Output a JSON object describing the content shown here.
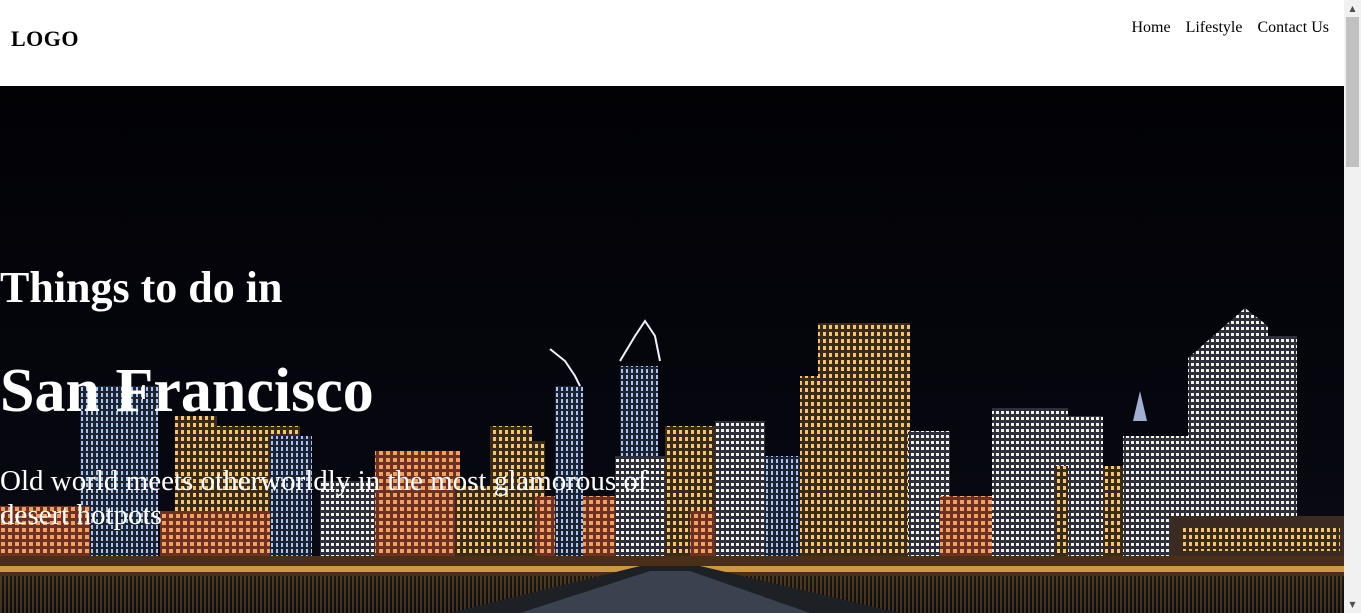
{
  "header": {
    "logo": "LOGO",
    "nav": [
      "Home",
      "Lifestyle",
      "Contact Us"
    ]
  },
  "hero": {
    "title_small": "Things to do in",
    "title_large": "San Francisco",
    "subtitle": "Old world meets otherworldly in the most glamorous of desert hotpots",
    "image": "night-city-skyline-image"
  },
  "colors": {
    "header_bg": "#ffffff",
    "hero_bg": "#040408",
    "hero_text": "#ffffff"
  }
}
